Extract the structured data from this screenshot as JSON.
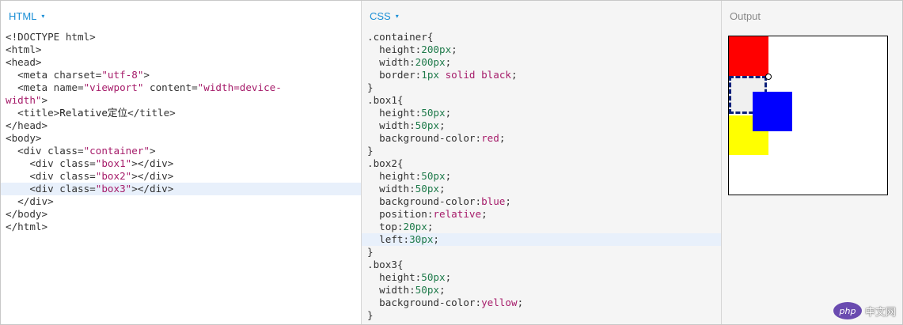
{
  "html_pane": {
    "title": "HTML",
    "caret": "▾",
    "lines": [
      [
        {
          "c": "tag",
          "t": "<!DOCTYPE html>"
        }
      ],
      [
        {
          "c": "tag",
          "t": "<html>"
        }
      ],
      [
        {
          "c": "tag",
          "t": "<head>"
        }
      ],
      [
        {
          "c": "tag",
          "t": "  <meta "
        },
        {
          "c": "attr",
          "t": "charset="
        },
        {
          "c": "val",
          "t": "\"utf-8\""
        },
        {
          "c": "tag",
          "t": ">"
        }
      ],
      [
        {
          "c": "tag",
          "t": "  <meta "
        },
        {
          "c": "attr",
          "t": "name="
        },
        {
          "c": "val",
          "t": "\"viewport\""
        },
        {
          "c": "attr",
          "t": " content="
        },
        {
          "c": "val",
          "t": "\"width=device-"
        }
      ],
      [
        {
          "c": "val",
          "t": "width\""
        },
        {
          "c": "tag",
          "t": ">"
        }
      ],
      [
        {
          "c": "tag",
          "t": "  <title>"
        },
        {
          "c": "text",
          "t": "Relative定位"
        },
        {
          "c": "tag",
          "t": "</title>"
        }
      ],
      [
        {
          "c": "tag",
          "t": "</head>"
        }
      ],
      [
        {
          "c": "tag",
          "t": "<body>"
        }
      ],
      [
        {
          "c": "tag",
          "t": "  <div "
        },
        {
          "c": "attr",
          "t": "class="
        },
        {
          "c": "val",
          "t": "\"container\""
        },
        {
          "c": "tag",
          "t": ">"
        }
      ],
      [
        {
          "c": "tag",
          "t": "    <div "
        },
        {
          "c": "attr",
          "t": "class="
        },
        {
          "c": "val",
          "t": "\"box1\""
        },
        {
          "c": "tag",
          "t": "></div>"
        }
      ],
      [
        {
          "c": "tag",
          "t": "    <div "
        },
        {
          "c": "attr",
          "t": "class="
        },
        {
          "c": "val",
          "t": "\"box2\""
        },
        {
          "c": "tag",
          "t": "></div>"
        }
      ],
      [
        {
          "c": "tag",
          "t": "    <div "
        },
        {
          "c": "attr",
          "t": "class="
        },
        {
          "c": "val",
          "t": "\"box3\""
        },
        {
          "c": "tag",
          "t": "></div>"
        }
      ],
      [
        {
          "c": "tag",
          "t": "  </div>"
        }
      ],
      [
        {
          "c": "tag",
          "t": "</body>"
        }
      ],
      [
        {
          "c": "tag",
          "t": "</html>"
        }
      ]
    ],
    "highlighted_line": 12
  },
  "css_pane": {
    "title": "CSS",
    "caret": "▾",
    "lines": [
      [
        {
          "c": "sel",
          "t": ".container{"
        }
      ],
      [
        {
          "c": "sel",
          "t": "  height:"
        },
        {
          "c": "num",
          "t": "200px"
        },
        {
          "c": "sel",
          "t": ";"
        }
      ],
      [
        {
          "c": "sel",
          "t": "  width:"
        },
        {
          "c": "num",
          "t": "200px"
        },
        {
          "c": "sel",
          "t": ";"
        }
      ],
      [
        {
          "c": "sel",
          "t": "  border:"
        },
        {
          "c": "num",
          "t": "1px"
        },
        {
          "c": "kw",
          "t": " solid black"
        },
        {
          "c": "sel",
          "t": ";"
        }
      ],
      [
        {
          "c": "sel",
          "t": "}"
        }
      ],
      [
        {
          "c": "sel",
          "t": ".box1{"
        }
      ],
      [
        {
          "c": "sel",
          "t": "  height:"
        },
        {
          "c": "num",
          "t": "50px"
        },
        {
          "c": "sel",
          "t": ";"
        }
      ],
      [
        {
          "c": "sel",
          "t": "  width:"
        },
        {
          "c": "num",
          "t": "50px"
        },
        {
          "c": "sel",
          "t": ";"
        }
      ],
      [
        {
          "c": "sel",
          "t": "  background-color:"
        },
        {
          "c": "kw",
          "t": "red"
        },
        {
          "c": "sel",
          "t": ";"
        }
      ],
      [
        {
          "c": "sel",
          "t": "}"
        }
      ],
      [
        {
          "c": "sel",
          "t": ".box2{"
        }
      ],
      [
        {
          "c": "sel",
          "t": "  height:"
        },
        {
          "c": "num",
          "t": "50px"
        },
        {
          "c": "sel",
          "t": ";"
        }
      ],
      [
        {
          "c": "sel",
          "t": "  width:"
        },
        {
          "c": "num",
          "t": "50px"
        },
        {
          "c": "sel",
          "t": ";"
        }
      ],
      [
        {
          "c": "sel",
          "t": "  background-color:"
        },
        {
          "c": "kw",
          "t": "blue"
        },
        {
          "c": "sel",
          "t": ";"
        }
      ],
      [
        {
          "c": "sel",
          "t": "  position:"
        },
        {
          "c": "kw",
          "t": "relative"
        },
        {
          "c": "sel",
          "t": ";"
        }
      ],
      [
        {
          "c": "sel",
          "t": "  top:"
        },
        {
          "c": "num",
          "t": "20px"
        },
        {
          "c": "sel",
          "t": ";"
        }
      ],
      [
        {
          "c": "sel",
          "t": "  left:"
        },
        {
          "c": "num",
          "t": "30px"
        },
        {
          "c": "sel",
          "t": ";"
        }
      ],
      [
        {
          "c": "sel",
          "t": "}"
        }
      ],
      [
        {
          "c": "sel",
          "t": ".box3{"
        }
      ],
      [
        {
          "c": "sel",
          "t": "  height:"
        },
        {
          "c": "num",
          "t": "50px"
        },
        {
          "c": "sel",
          "t": ";"
        }
      ],
      [
        {
          "c": "sel",
          "t": "  width:"
        },
        {
          "c": "num",
          "t": "50px"
        },
        {
          "c": "sel",
          "t": ";"
        }
      ],
      [
        {
          "c": "sel",
          "t": "  background-color:"
        },
        {
          "c": "kw",
          "t": "yellow"
        },
        {
          "c": "sel",
          "t": ";"
        }
      ],
      [
        {
          "c": "sel",
          "t": "}"
        }
      ]
    ],
    "highlighted_line": 16
  },
  "output_pane": {
    "title": "Output",
    "box_colors": {
      "box1": "#ff0000",
      "box2": "#0000ff",
      "box3": "#ffff00"
    }
  },
  "watermark": {
    "logo": "php",
    "text": "中文网"
  }
}
